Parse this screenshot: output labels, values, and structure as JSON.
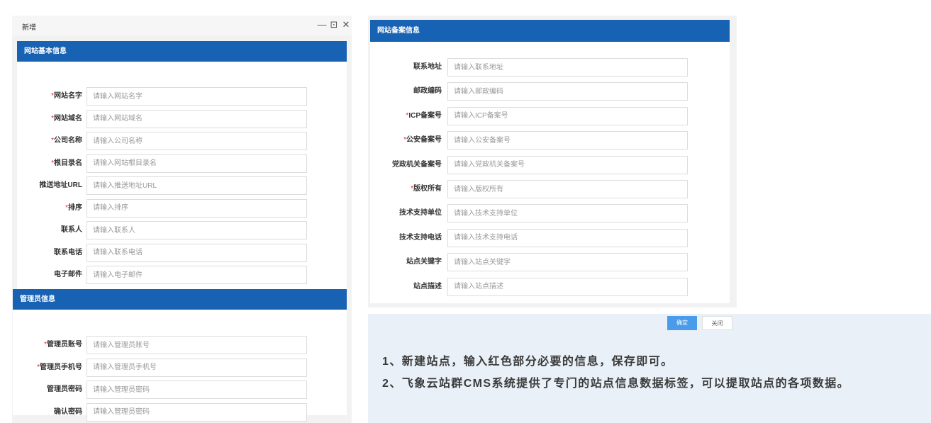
{
  "dialog": {
    "title": "新增",
    "controls": {
      "minimize": "—",
      "maximize": "⊡",
      "close": "✕"
    }
  },
  "basic_info": {
    "header": "网站基本信息",
    "fields": [
      {
        "label": "网站名字",
        "required": true,
        "placeholder": "请输入网站名字",
        "value": ""
      },
      {
        "label": "网站域名",
        "required": true,
        "placeholder": "请输入网站域名",
        "value": ""
      },
      {
        "label": "公司名称",
        "required": true,
        "placeholder": "请输入公司名称",
        "value": ""
      },
      {
        "label": "根目录名",
        "required": true,
        "placeholder": "请输入网站根目录名",
        "value": ""
      },
      {
        "label": "推送地址URL",
        "required": false,
        "placeholder": "请输入推送地址URL",
        "value": ""
      },
      {
        "label": "排序",
        "required": true,
        "placeholder": "请输入排序",
        "value": ""
      },
      {
        "label": "联系人",
        "required": false,
        "placeholder": "请输入联系人",
        "value": ""
      },
      {
        "label": "联系电话",
        "required": false,
        "placeholder": "请输入联系电话",
        "value": ""
      },
      {
        "label": "电子邮件",
        "required": false,
        "placeholder": "请输入电子邮件",
        "value": ""
      }
    ]
  },
  "admin_info": {
    "header": "管理员信息",
    "fields": [
      {
        "label": "管理员账号",
        "required": true,
        "placeholder": "请输入管理员账号",
        "value": ""
      },
      {
        "label": "管理员手机号",
        "required": true,
        "placeholder": "请输入管理员手机号",
        "value": ""
      },
      {
        "label": "管理员密码",
        "required": false,
        "placeholder": "请输入管理员密码",
        "value": ""
      },
      {
        "label": "确认密码",
        "required": false,
        "placeholder": "请输入管理员密码",
        "value": ""
      }
    ]
  },
  "record_info": {
    "header": "网站备案信息",
    "fields": [
      {
        "label": "联系地址",
        "required": false,
        "placeholder": "请输入联系地址",
        "value": ""
      },
      {
        "label": "邮政编码",
        "required": false,
        "placeholder": "请输入邮政编码",
        "value": ""
      },
      {
        "label": "ICP备案号",
        "required": true,
        "placeholder": "请输入ICP备案号",
        "value": ""
      },
      {
        "label": "公安备案号",
        "required": true,
        "placeholder": "请输入公安备案号",
        "value": ""
      },
      {
        "label": "党政机关备案号",
        "required": false,
        "placeholder": "请输入党政机关备案号",
        "value": ""
      },
      {
        "label": "版权所有",
        "required": true,
        "placeholder": "请输入版权所有",
        "value": ""
      },
      {
        "label": "技术支持单位",
        "required": false,
        "placeholder": "请输入技术支持单位",
        "value": ""
      },
      {
        "label": "技术支持电话",
        "required": false,
        "placeholder": "请输入技术支持电话",
        "value": ""
      },
      {
        "label": "站点关键字",
        "required": false,
        "placeholder": "请输入站点关键字",
        "value": ""
      },
      {
        "label": "站点描述",
        "required": false,
        "placeholder": "请输入站点描述",
        "value": ""
      }
    ]
  },
  "actions": {
    "confirm": "确定",
    "close": "关闭"
  },
  "tips": [
    "1、新建站点，输入红色部分必要的信息，保存即可。",
    "2、飞象云站群CMS系统提供了专门的站点信息数据标签，可以提取站点的各项数据。"
  ],
  "colors": {
    "header_blue": "#1862b4",
    "required_red": "#e0262c",
    "confirm_blue": "#4a9bea",
    "tip_bg": "#e9f0f8"
  }
}
